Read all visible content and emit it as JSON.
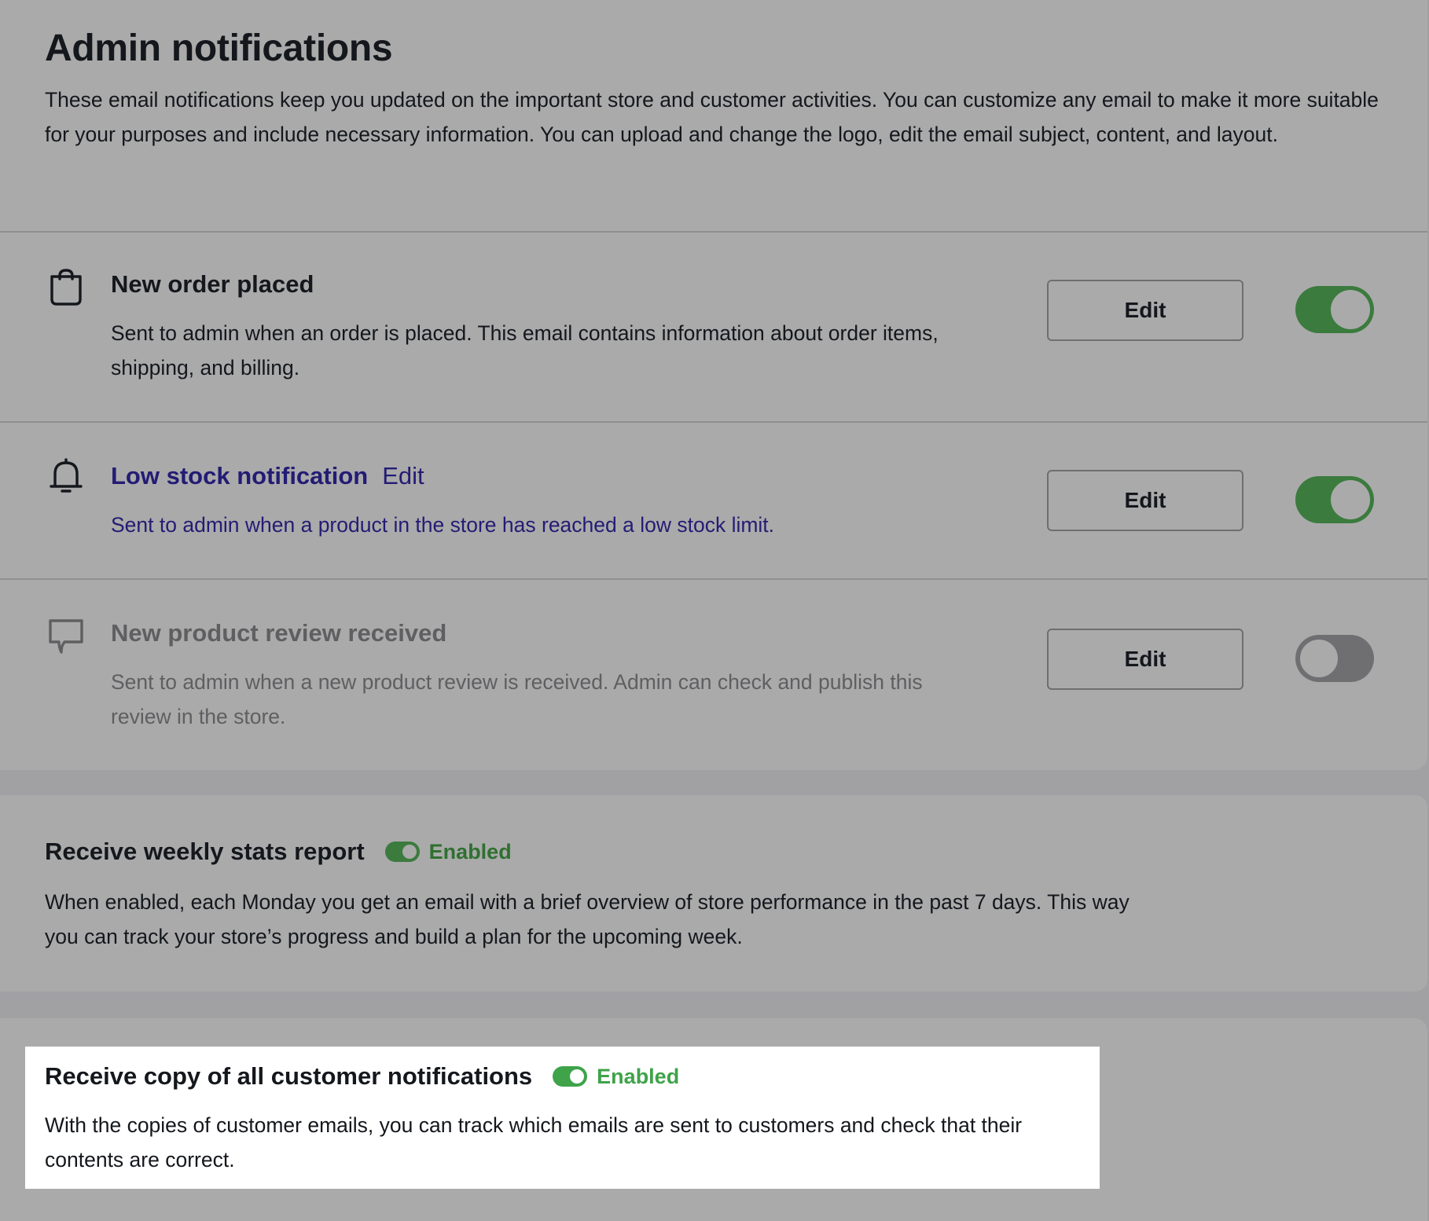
{
  "header": {
    "title": "Admin notifications",
    "description": "These email notifications keep you updated on the important store and customer activities. You can customize any email to make it more suitable for your purposes and include necessary information. You can upload and change the logo, edit the email subject, content, and layout."
  },
  "notifications": [
    {
      "icon": "shopping-bag-icon",
      "title": "New order placed",
      "description": "Sent to admin when an order is placed. This email contains information about order items, shipping, and billing.",
      "edit_label": "Edit",
      "enabled": true
    },
    {
      "icon": "bell-icon",
      "title": "Low stock notification",
      "title_edit_link": "Edit",
      "description": "Sent to admin when a product in the store has reached a low stock limit.",
      "edit_label": "Edit",
      "enabled": true
    },
    {
      "icon": "comment-icon",
      "title": "New product review received",
      "description": "Sent to admin when a new product review is received. Admin can check and publish this review in the store.",
      "edit_label": "Edit",
      "enabled": false
    }
  ],
  "weekly_report": {
    "title": "Receive weekly stats report",
    "status": "Enabled",
    "description": "When enabled, each Monday you get an email with a brief overview of store performance in the past 7 days. This way you can track your store’s progress and build a plan for the upcoming week."
  },
  "customer_copy": {
    "title": "Receive copy of all customer notifications",
    "status": "Enabled",
    "description": "With the copies of customer emails, you can track which emails are sent to customers and check that their contents are correct."
  },
  "colors": {
    "toggle_on": "#3b7b3e",
    "toggle_off": "#6f6f72",
    "link": "#231c74",
    "enabled_text": "#2f7031",
    "highlight_enabled": "#3fa34a"
  }
}
